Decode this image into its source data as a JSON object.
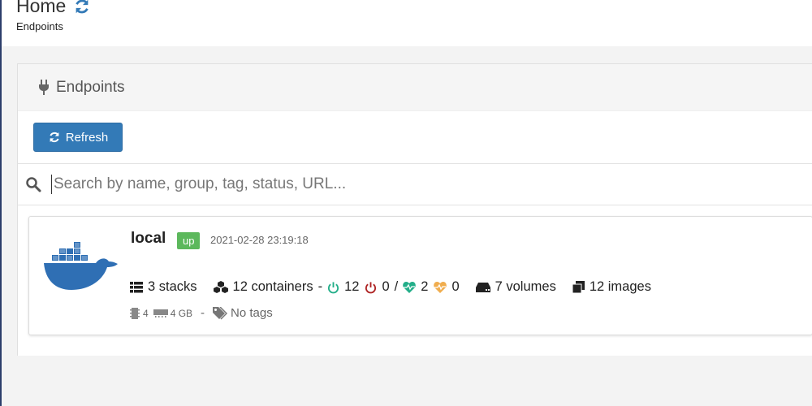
{
  "header": {
    "title": "Home",
    "breadcrumb": "Endpoints"
  },
  "widget": {
    "title": "Endpoints",
    "refresh_label": "Refresh",
    "search": {
      "placeholder": "Search by name, group, tag, status, URL...",
      "value": ""
    }
  },
  "endpoint": {
    "name": "local",
    "status": "up",
    "timestamp": "2021-02-28 23:19:18",
    "stacks": "3 stacks",
    "containers": "12 containers",
    "dash": "-",
    "running": "12",
    "stopped": "0",
    "slash": "/",
    "healthy": "2",
    "unhealthy": "0",
    "volumes": "7 volumes",
    "images": "12 images",
    "cpu": "4",
    "memory": "4 GB",
    "meta_sep": "-",
    "tags": "No tags"
  },
  "colors": {
    "primary": "#337ab7",
    "status_up": "#5cb85c",
    "running": "#23ae89",
    "stopped": "#ae2323",
    "healthy": "#23ae89",
    "unhealthy": "#f0ad4e",
    "docker_blue": "#2f6fb4"
  },
  "icons": {
    "title": "refresh-icon",
    "widget": "plug-icon",
    "search": "search-icon",
    "logo": "docker-logo"
  }
}
